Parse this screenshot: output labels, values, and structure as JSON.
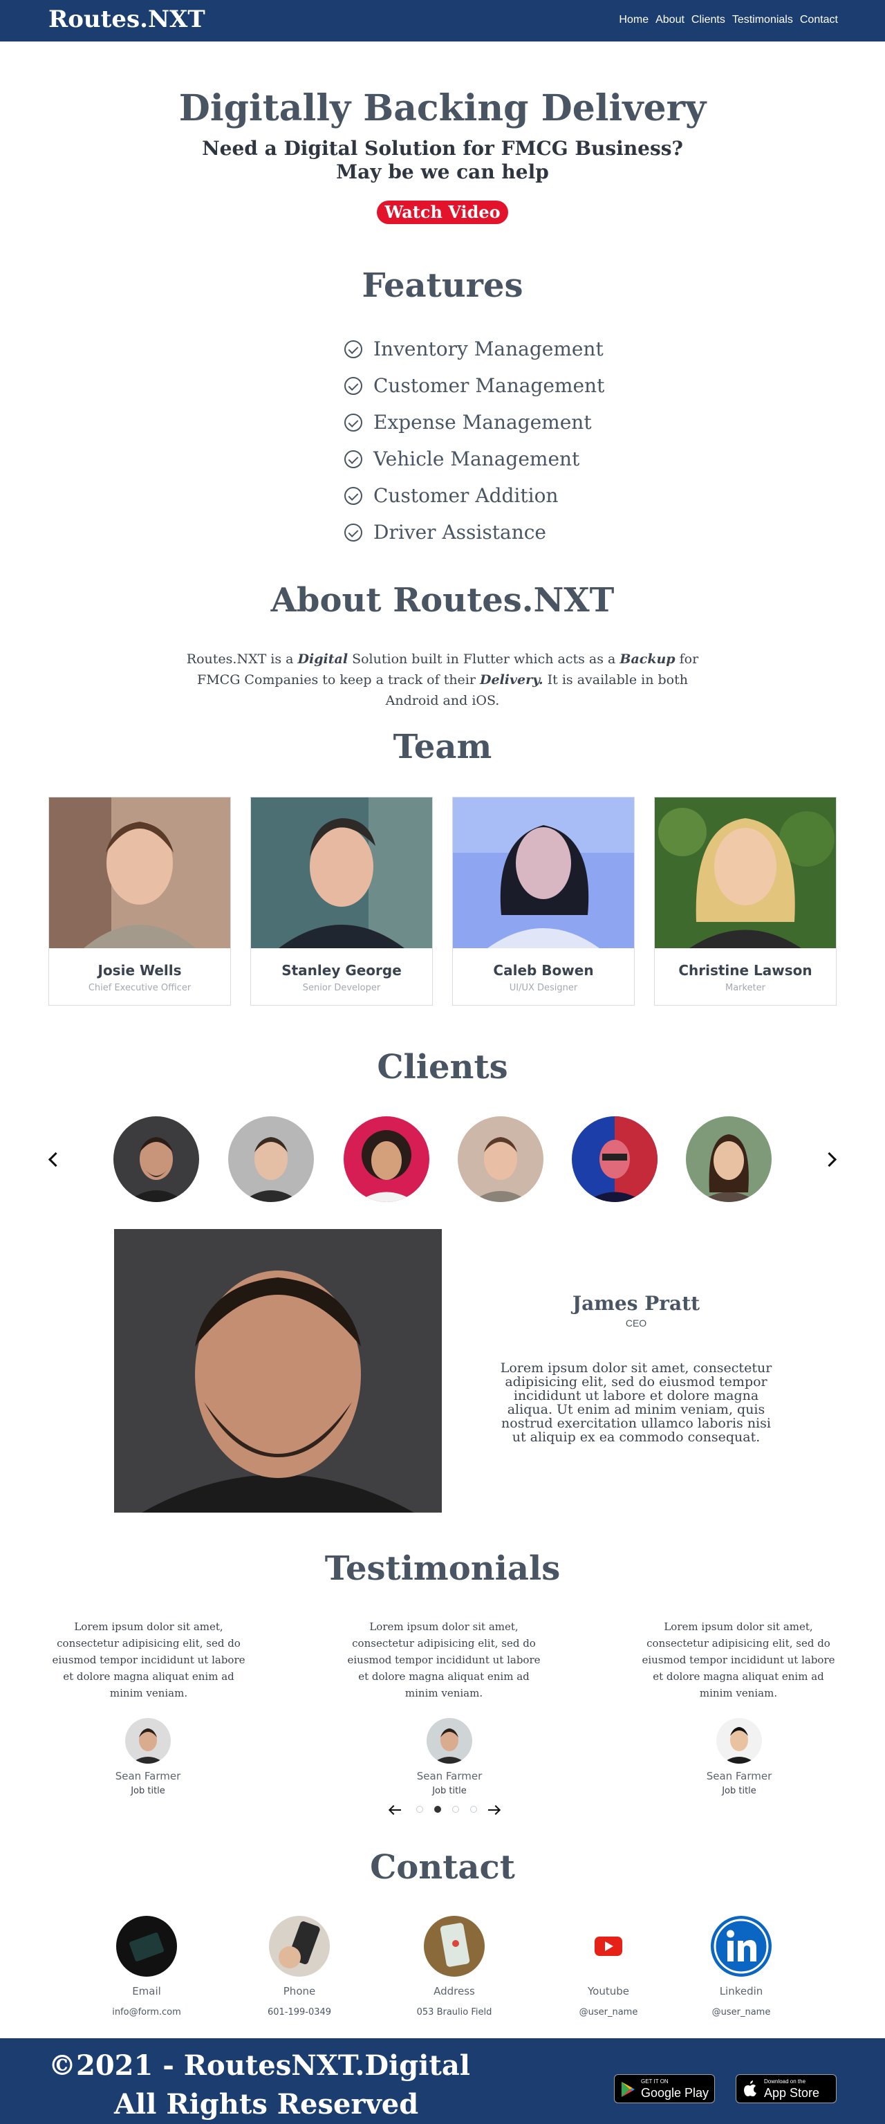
{
  "nav": {
    "brand": "Routes.NXT",
    "links": [
      "Home",
      "About",
      "Clients",
      "Testimonials",
      "Contact"
    ]
  },
  "hero": {
    "title": "Digitally Backing Delivery",
    "subtitle_line1": "Need a Digital Solution for FMCG Business?",
    "subtitle_line2": "May be we can help",
    "cta": "Watch Video",
    "cta_color": "#e3132b"
  },
  "features": {
    "title": "Features",
    "items": [
      "Inventory Management",
      "Customer Management",
      "Expense Management",
      "Vehicle Management",
      "Customer Addition",
      "Driver Assistance"
    ]
  },
  "about": {
    "title": "About Routes.NXT",
    "text_before_digital": "Routes.NXT is a ",
    "digital": "Digital",
    "text_after_digital": " Solution built in Flutter which acts as a ",
    "backup": "Backup",
    "text_after_backup": " for FMCG Companies to keep a track of their ",
    "delivery": "Delivery.",
    "text_end": " It is available in both Android and iOS."
  },
  "team": {
    "title": "Team",
    "members": [
      {
        "name": "Josie Wells",
        "role": "Chief Executive Officer"
      },
      {
        "name": "Stanley George",
        "role": "Senior Developer"
      },
      {
        "name": "Caleb Bowen",
        "role": "UI/UX Designer"
      },
      {
        "name": "Christine Lawson",
        "role": "Marketer"
      }
    ]
  },
  "clients": {
    "title": "Clients",
    "featured": {
      "name": "James Pratt",
      "role": "CEO",
      "quote": "Lorem ipsum dolor sit amet, consectetur adipisicing elit, sed do eiusmod tempor incididunt ut labore et dolore magna aliqua. Ut enim ad minim veniam, quis nostrud exercitation ullamco laboris nisi ut aliquip ex ea commodo consequat."
    }
  },
  "testimonials": {
    "title": "Testimonials",
    "items": [
      {
        "text": "Lorem ipsum dolor sit amet, consectetur adipisicing elit, sed do eiusmod tempor incididunt ut labore et dolore magna aliquat enim ad minim veniam.",
        "name": "Sean Farmer",
        "job": "Job title"
      },
      {
        "text": "Lorem ipsum dolor sit amet, consectetur adipisicing elit, sed do eiusmod tempor incididunt ut labore et dolore magna aliquat enim ad minim veniam.",
        "name": "Sean Farmer",
        "job": "Job title"
      },
      {
        "text": "Lorem ipsum dolor sit amet, consectetur adipisicing elit, sed do eiusmod tempor incididunt ut labore et dolore magna aliquat enim ad minim veniam.",
        "name": "Sean Farmer",
        "job": "Job title"
      }
    ],
    "active_page": 2,
    "page_count": 4
  },
  "contact": {
    "title": "Contact",
    "items": [
      {
        "label": "Email",
        "value": "info@form.com"
      },
      {
        "label": "Phone",
        "value": "601-199-0349"
      },
      {
        "label": "Address",
        "value": "053 Braulio Field"
      },
      {
        "label": "Youtube",
        "value": "@user_name"
      },
      {
        "label": "Linkedin",
        "value": "@user_name"
      }
    ]
  },
  "footer": {
    "copyright_line1": "©2021 - RoutesNXT.Digital",
    "copyright_line2": "All Rights Reserved",
    "google_play_small": "GET IT ON",
    "google_play_big": "Google Play",
    "app_store_small": "Download on the",
    "app_store_big": "App Store"
  },
  "colors": {
    "nav_bg": "#1b3d70",
    "heading": "#4a5563",
    "youtube_red": "#e62117",
    "linkedin_blue": "#0a66c2"
  }
}
